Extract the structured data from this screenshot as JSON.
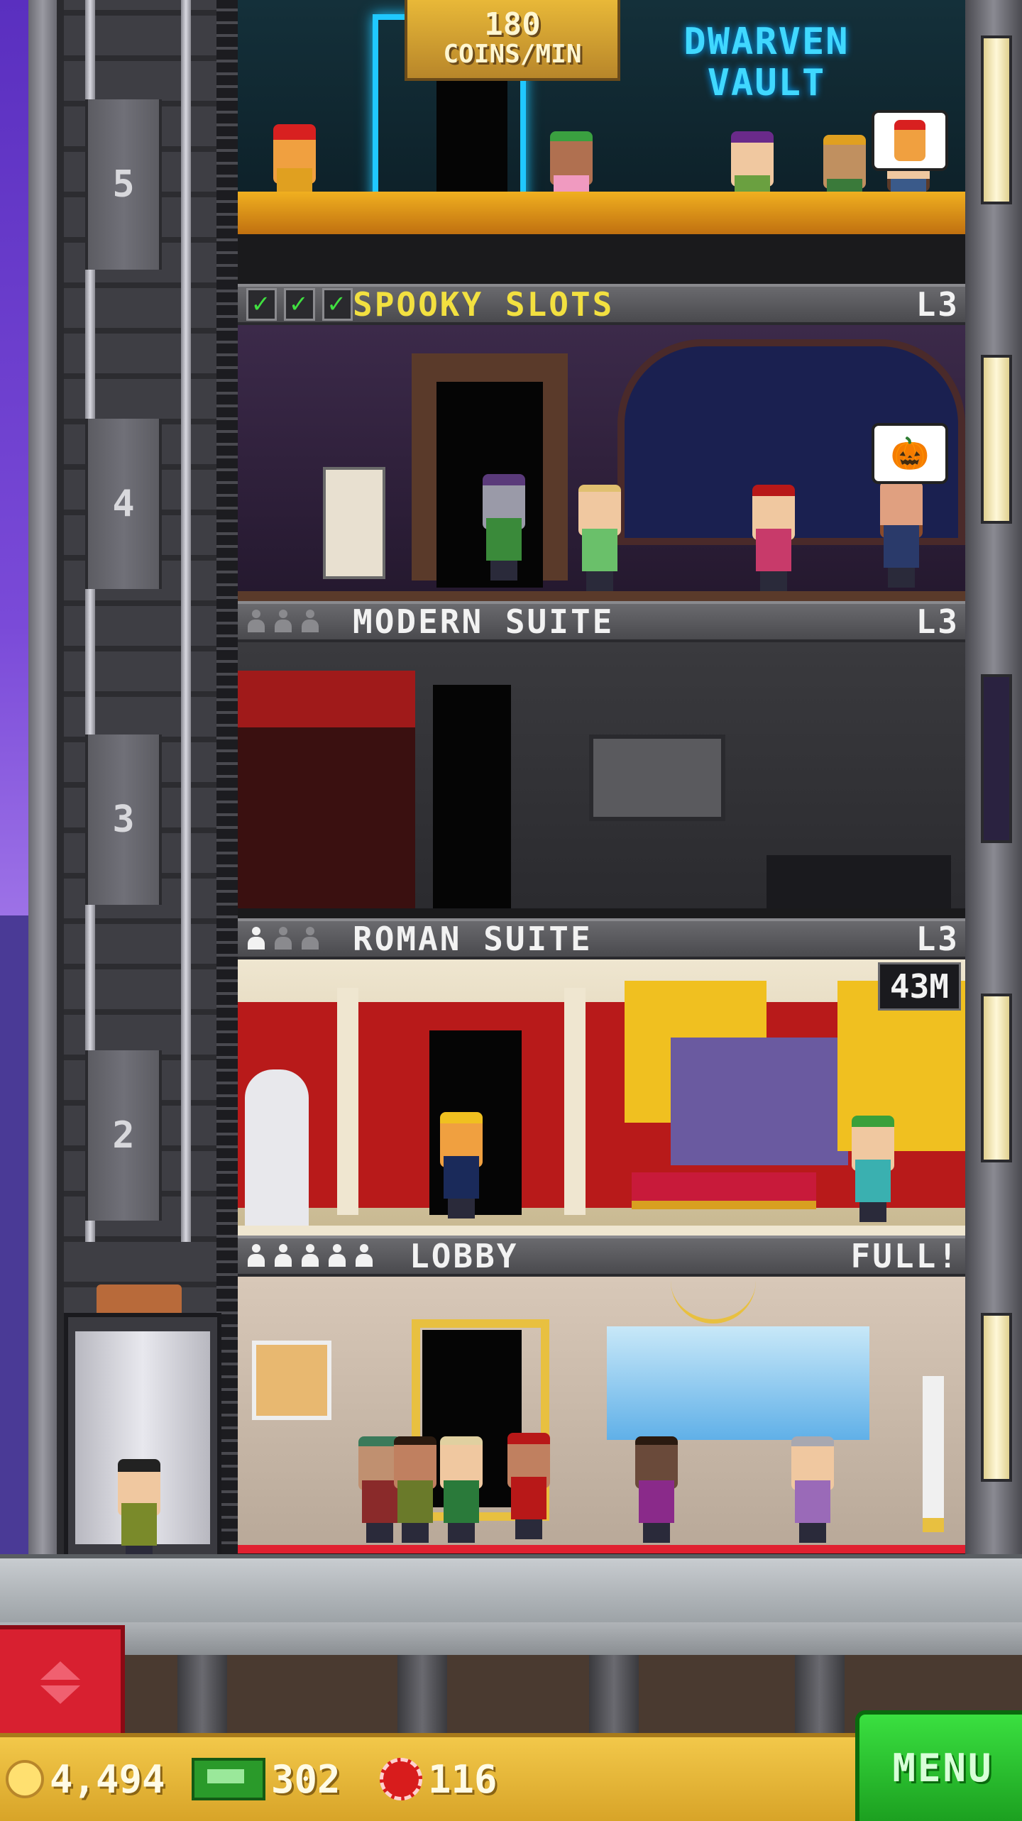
{
  "hud": {
    "coins": "4,494",
    "bux": "302",
    "chips": "116",
    "menu_label": "MENU"
  },
  "top_floor": {
    "income_value": "180",
    "income_unit": "COINS/MIN",
    "sign_line1": "DWARVEN",
    "sign_line2": "VAULT",
    "bubble_icon": "gnome-icon"
  },
  "elevator": {
    "floor_numbers": [
      "5",
      "4",
      "3",
      "2"
    ]
  },
  "floors": [
    {
      "name": "SPOOKY SLOTS",
      "level": "L3",
      "stars_type": "checks",
      "checks": 3,
      "bubble": "🎃"
    },
    {
      "name": "MODERN SUITE",
      "level": "L3",
      "stars_type": "pawns",
      "occupied": 0,
      "capacity": 3
    },
    {
      "name": "ROMAN SUITE",
      "level": "L3",
      "stars_type": "pawns",
      "occupied": 1,
      "capacity": 3,
      "timer": "43M"
    },
    {
      "name": "LOBBY",
      "level": "FULL!",
      "stars_type": "pawns",
      "occupied": 5,
      "capacity": 5
    }
  ],
  "colors": {
    "menu_green": "#1ca020",
    "hud_gold": "#f2c84a",
    "updown_red": "#d82030",
    "neon_blue": "#40d8ff"
  }
}
